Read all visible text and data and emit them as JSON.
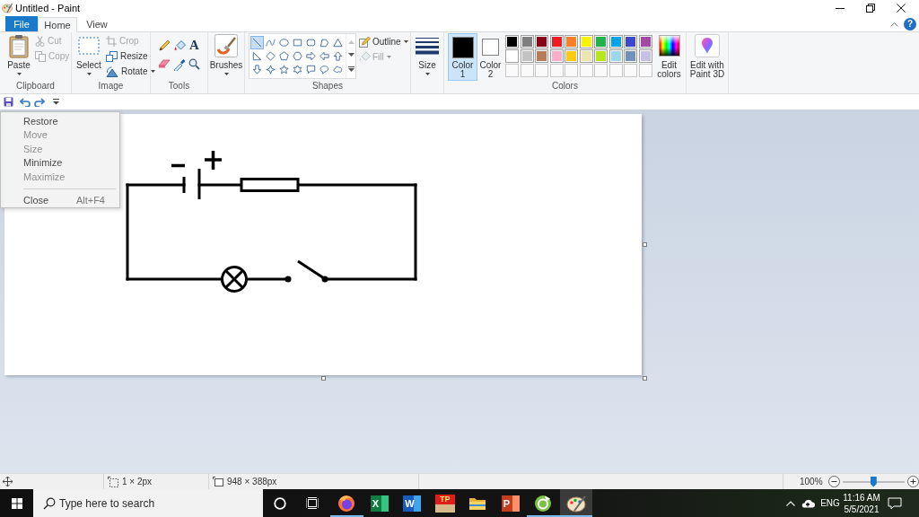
{
  "window": {
    "title": "Untitled - Paint"
  },
  "system_menu": {
    "items": [
      {
        "label": "Restore",
        "disabled": false
      },
      {
        "label": "Move",
        "disabled": true
      },
      {
        "label": "Size",
        "disabled": true
      },
      {
        "label": "Minimize",
        "disabled": false
      },
      {
        "label": "Maximize",
        "disabled": true
      },
      {
        "label": "Close",
        "disabled": false,
        "shortcut": "Alt+F4"
      }
    ]
  },
  "tabs": [
    {
      "kind": "file",
      "label": "File",
      "selected": false
    },
    {
      "kind": "tab",
      "label": "Home",
      "selected": true
    },
    {
      "kind": "tab",
      "label": "View",
      "selected": false
    }
  ],
  "help_button": "?",
  "ribbon": {
    "clipboard": {
      "label": "Clipboard",
      "paste": {
        "label": "Paste",
        "disabled": false
      },
      "commands": [
        {
          "kind": "cut",
          "label": "Cut",
          "disabled": true
        },
        {
          "kind": "copy",
          "label": "Copy",
          "disabled": true
        }
      ]
    },
    "image": {
      "label": "Image",
      "select": {
        "label": "Select",
        "disabled": false
      },
      "commands": [
        {
          "kind": "crop",
          "label": "Crop",
          "disabled": true
        },
        {
          "kind": "resize",
          "label": "Resize",
          "disabled": false
        },
        {
          "kind": "rotate",
          "label": "Rotate",
          "disabled": false
        }
      ]
    },
    "tools": {
      "label": "Tools",
      "items": [
        {
          "kind": "pencil"
        },
        {
          "kind": "fill"
        },
        {
          "kind": "text",
          "glyph": "A"
        },
        {
          "kind": "eraser"
        },
        {
          "kind": "picker"
        },
        {
          "kind": "magnifier"
        }
      ]
    },
    "brushes": {
      "label": "Brushes"
    },
    "shapes": {
      "label": "Shapes",
      "gallery": [
        {
          "kind": "line",
          "selected": true
        },
        {
          "kind": "curve",
          "selected": false
        },
        {
          "kind": "oval",
          "selected": false
        },
        {
          "kind": "rectangle",
          "selected": false
        },
        {
          "kind": "roundrect",
          "selected": false
        },
        {
          "kind": "polygon",
          "selected": false
        },
        {
          "kind": "triangle",
          "selected": false
        },
        {
          "kind": "righttriangle",
          "selected": false
        },
        {
          "kind": "diamond",
          "selected": false
        },
        {
          "kind": "pentagon",
          "selected": false
        },
        {
          "kind": "hexagon",
          "selected": false
        },
        {
          "kind": "rightarrow",
          "selected": false
        },
        {
          "kind": "leftarrow",
          "selected": false
        },
        {
          "kind": "uparrow",
          "selected": false
        },
        {
          "kind": "downarrow",
          "selected": false
        },
        {
          "kind": "star4",
          "selected": false
        },
        {
          "kind": "star5",
          "selected": false
        },
        {
          "kind": "star6",
          "selected": false
        },
        {
          "kind": "rectcallout",
          "selected": false
        },
        {
          "kind": "ovalcallout",
          "selected": false
        },
        {
          "kind": "cloudcallout",
          "selected": false
        }
      ],
      "commands": [
        {
          "kind": "outline",
          "label": "Outline",
          "disabled": false
        },
        {
          "kind": "fill",
          "label": "Fill",
          "disabled": true
        }
      ]
    },
    "size": {
      "label": "Size"
    },
    "colors": {
      "label": "Colors",
      "slots": [
        {
          "label": "Color 1",
          "color": "#000000",
          "selected": true
        },
        {
          "label": "Color 2",
          "color": "#ffffff",
          "selected": false
        }
      ],
      "palette": [
        {
          "kind": "swatch",
          "color": "#000000"
        },
        {
          "kind": "swatch",
          "color": "#7f7f7f"
        },
        {
          "kind": "swatch",
          "color": "#880015"
        },
        {
          "kind": "swatch",
          "color": "#ed1c24"
        },
        {
          "kind": "swatch",
          "color": "#ff7f27"
        },
        {
          "kind": "swatch",
          "color": "#fff200"
        },
        {
          "kind": "swatch",
          "color": "#22b14c"
        },
        {
          "kind": "swatch",
          "color": "#00a2e8"
        },
        {
          "kind": "swatch",
          "color": "#3f48cc"
        },
        {
          "kind": "swatch",
          "color": "#a349a4"
        },
        {
          "kind": "swatch",
          "color": "#ffffff"
        },
        {
          "kind": "swatch",
          "color": "#c3c3c3"
        },
        {
          "kind": "swatch",
          "color": "#b97a57"
        },
        {
          "kind": "swatch",
          "color": "#ffaec9"
        },
        {
          "kind": "swatch",
          "color": "#ffc90e"
        },
        {
          "kind": "swatch",
          "color": "#efe4b0"
        },
        {
          "kind": "swatch",
          "color": "#b5e61d"
        },
        {
          "kind": "swatch",
          "color": "#99d9ea"
        },
        {
          "kind": "swatch",
          "color": "#7092be"
        },
        {
          "kind": "swatch",
          "color": "#c8bfe7"
        },
        {
          "kind": "empty"
        },
        {
          "kind": "empty"
        },
        {
          "kind": "empty"
        },
        {
          "kind": "empty"
        },
        {
          "kind": "empty"
        },
        {
          "kind": "empty"
        },
        {
          "kind": "empty"
        },
        {
          "kind": "empty"
        },
        {
          "kind": "empty"
        },
        {
          "kind": "empty"
        }
      ],
      "edit": "Edit colors"
    },
    "paint3d": {
      "label": "Edit with Paint 3D"
    }
  },
  "quick_access": [
    {
      "kind": "save"
    },
    {
      "kind": "undo"
    },
    {
      "kind": "redo"
    },
    {
      "kind": "customize"
    }
  ],
  "status_bar": {
    "selection_size": "1 × 2px",
    "canvas_size": "948 × 388px",
    "zoom": "100%",
    "zoom_slider": {
      "level": 0.5
    }
  },
  "taskbar": {
    "search": {
      "placeholder": "Type here to search"
    },
    "apps": [
      {
        "kind": "browser",
        "running": true,
        "selected": false
      },
      {
        "kind": "spreadsheet",
        "glyph": "X",
        "running": false,
        "selected": false
      },
      {
        "kind": "document",
        "glyph": "W",
        "running": false,
        "selected": false
      },
      {
        "kind": "tile",
        "glyph": "TP",
        "running": false,
        "selected": false
      },
      {
        "kind": "folder",
        "running": false,
        "selected": false
      },
      {
        "kind": "slides",
        "glyph": "P",
        "running": false,
        "selected": false
      },
      {
        "kind": "capture",
        "running": true,
        "selected": false
      },
      {
        "kind": "paint",
        "running": true,
        "selected": true
      }
    ],
    "tray": {
      "language": "ENG",
      "time": "11:16 AM",
      "date": "5/5/2021"
    }
  }
}
